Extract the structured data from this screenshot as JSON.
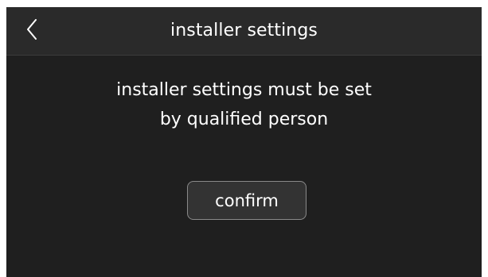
{
  "header": {
    "title": "installer settings",
    "back_icon": "chevron-left-icon"
  },
  "message": {
    "line1": "installer settings must be set",
    "line2": "by qualified person"
  },
  "actions": {
    "confirm_label": "confirm"
  },
  "colors": {
    "background": "#1f1f1f",
    "header_background": "#2a2a2a",
    "text": "#ffffff",
    "button_border": "#8a8a8a",
    "button_background": "#333333"
  }
}
